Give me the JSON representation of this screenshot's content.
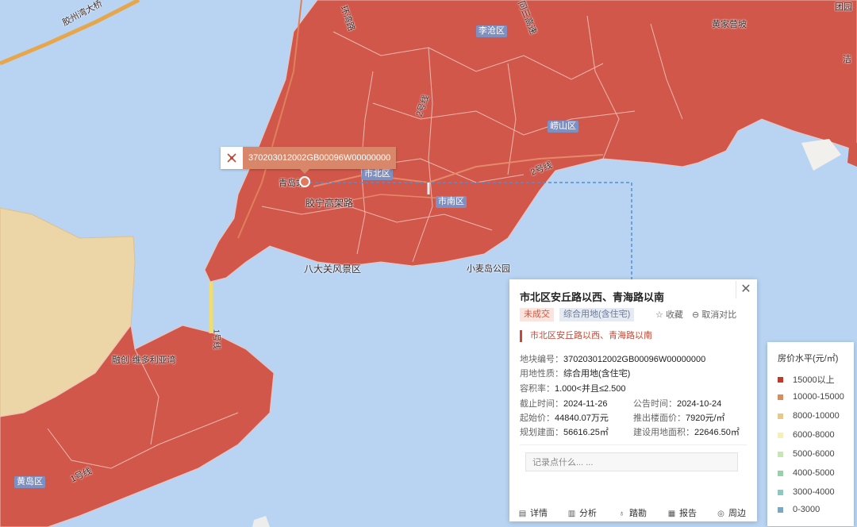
{
  "colors": {
    "water": "#b8d4f2",
    "high": "#d35a4d",
    "mid_high": "#d89a73",
    "mid": "#e9cfa0"
  },
  "map_labels": {
    "bridge": "胶州湾大桥",
    "huan": "环湾路",
    "jiaoning": "胶宁高架路",
    "badaguan": "八大关风景区",
    "xiaomai": "小麦岛公园",
    "rongchuang": "融创·维多利亚湾",
    "line1": "1号线",
    "line1b": "1号线",
    "line2": "2号线",
    "huangdao_tower": "黄岛区",
    "qingdao_station": "青岛站",
    "tongsanshu": "同三高速",
    "huangjiayou": "黄家营坡",
    "top_right_a": "团园",
    "top_right_b": "洁",
    "line2b": "2号线"
  },
  "districts": {
    "licang": "李沧区",
    "shibei": "市北区",
    "laoshan": "崂山区",
    "shinan": "市南区",
    "huangdao": "黄岛区"
  },
  "parcel_tooltip": {
    "code": "370203012002GB00096W00000000"
  },
  "panel": {
    "title": "市北区安丘路以西、青海路以南",
    "status_tag": "未成交",
    "use_tag": "综合用地(含住宅)",
    "favorite": "收藏",
    "cancel_compare": "取消对比",
    "subtitle": "市北区安丘路以西、青海路以南",
    "fields": {
      "code_label": "地块编号：",
      "code": "370203012002GB00096W00000000",
      "nature_label": "用地性质：",
      "nature": "综合用地(含住宅)",
      "far_label": "容积率：",
      "far": "1.000<并且≤2.500",
      "deadline_label": "截止时间：",
      "deadline": "2024-11-26",
      "announce_label": "公告时间：",
      "announce": "2024-10-24",
      "start_price_label": "起始价：",
      "start_price": "44840.07万元",
      "floor_price_label": "推出楼面价：",
      "floor_price": "7920元/㎡",
      "planned_area_label": "规划建面：",
      "planned_area": "56616.25㎡",
      "land_area_label": "建设用地面积：",
      "land_area": "22646.50㎡"
    },
    "note_placeholder": "记录点什么... ...",
    "bottom": [
      "详情",
      "分析",
      "踏勘",
      "报告",
      "周边"
    ]
  },
  "legend": {
    "title": "房价水平(元/㎡)",
    "items": [
      {
        "label": "15000以上",
        "color": "#c0392b"
      },
      {
        "label": "10000-15000",
        "color": "#d98d5f"
      },
      {
        "label": "8000-10000",
        "color": "#e8c98a"
      },
      {
        "label": "6000-8000",
        "color": "#f6f0b6"
      },
      {
        "label": "5000-6000",
        "color": "#c8e6b4"
      },
      {
        "label": "4000-5000",
        "color": "#98d0a8"
      },
      {
        "label": "3000-4000",
        "color": "#8ccac0"
      },
      {
        "label": "0-3000",
        "color": "#79a9c2"
      }
    ]
  }
}
